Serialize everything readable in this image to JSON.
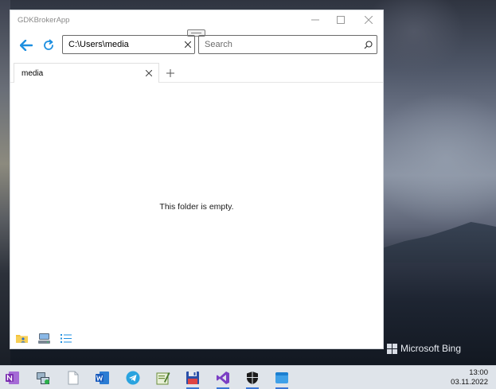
{
  "window": {
    "title": "GDKBrokerApp",
    "controls": {
      "minimize": "minimize-icon",
      "maximize": "maximize-icon",
      "close": "close-icon"
    }
  },
  "toolbar": {
    "path_value": "C:\\Users\\media",
    "search_placeholder": "Search",
    "back_icon": "arrow-left-icon",
    "refresh_icon": "refresh-icon"
  },
  "tabs": [
    {
      "label": "media"
    }
  ],
  "content": {
    "empty_message": "This folder is empty."
  },
  "bottom_bar": {
    "buttons": [
      "folder-user-icon",
      "drive-icon",
      "list-view-icon"
    ]
  },
  "desktop": {
    "watermark": "Microsoft Bing"
  },
  "taskbar": {
    "time": "13:00",
    "date": "03.11.2022",
    "apps": [
      "onenote",
      "broker",
      "notepad",
      "word",
      "telegram",
      "editor",
      "save",
      "visual-studio",
      "security",
      "app-window"
    ],
    "accent": "#3a76d6"
  }
}
